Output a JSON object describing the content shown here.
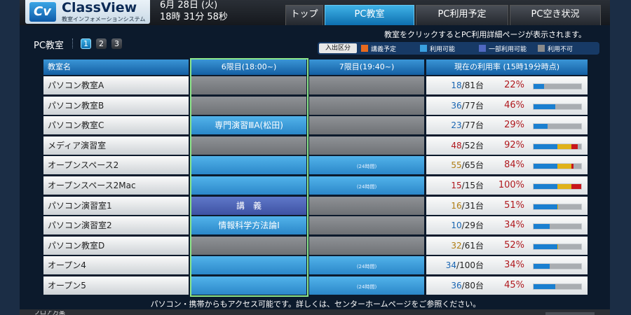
{
  "header": {
    "logo_title": "ClassView",
    "logo_subtitle": "教室インフォメーションシステム",
    "date": "6月 28日 (火)",
    "time": "18時 31分 58秒",
    "nav": [
      "トップ",
      "PC教室",
      "PC利用予定",
      "PC空き状況"
    ],
    "active_nav": "PC教室"
  },
  "subheader": {
    "title": "PC教室",
    "pages": [
      "1",
      "2",
      "3"
    ],
    "active_page": "1",
    "notice": "教室をクリックするとPC利用詳細ページが表示されます。"
  },
  "legend": {
    "title": "入出区分",
    "items": [
      {
        "label": "講義予定",
        "color": "#e86a1e"
      },
      {
        "label": "利用可能",
        "color": "#3aa0e0"
      },
      {
        "label": "一部利用可能",
        "color": "#5068c0"
      },
      {
        "label": "利用不可",
        "color": "#8a8a8a"
      }
    ]
  },
  "table": {
    "headers": [
      "教室名",
      "6限目(18:00~)",
      "7限目(19:40~)",
      "現在の利用率 (15時19分時点)"
    ],
    "rows": [
      {
        "name": "パソコン教室A",
        "p6": "",
        "p6_type": "gray",
        "p7": "",
        "p7_type": "gray",
        "used": "18",
        "total": "81台",
        "pct": "22%",
        "used_color": "#1a66b3",
        "fill": 0.22
      },
      {
        "name": "パソコン教室B",
        "p6": "",
        "p6_type": "gray",
        "p7": "",
        "p7_type": "gray",
        "used": "36",
        "total": "77台",
        "pct": "46%",
        "used_color": "#1a66b3",
        "fill": 0.46
      },
      {
        "name": "パソコン教室C",
        "p6": "専門演習ⅢA(松田)",
        "p6_type": "blue",
        "p7": "",
        "p7_type": "gray",
        "used": "23",
        "total": "77台",
        "pct": "29%",
        "used_color": "#1a66b3",
        "fill": 0.29
      },
      {
        "name": "メディア演習室",
        "p6": "",
        "p6_type": "gray",
        "p7": "",
        "p7_type": "gray",
        "used": "48",
        "total": "52台",
        "pct": "92%",
        "used_color": "#b0191e",
        "fill": 0.92
      },
      {
        "name": "オープンスペース2",
        "p6": "",
        "p6_type": "blue",
        "p7": "(24時間)",
        "p7_type": "blue",
        "used": "55",
        "total": "65台",
        "pct": "84%",
        "used_color": "#b07d12",
        "fill": 0.84
      },
      {
        "name": "オープンスペース2Mac",
        "p6": "",
        "p6_type": "blue",
        "p7": "(24時間)",
        "p7_type": "blue",
        "used": "15",
        "total": "15台",
        "pct": "100%",
        "used_color": "#b0191e",
        "fill": 1.0
      },
      {
        "name": "パソコン演習室1",
        "p6": "講　義",
        "p6_type": "class",
        "p7": "",
        "p7_type": "gray",
        "used": "16",
        "total": "31台",
        "pct": "51%",
        "used_color": "#b07d12",
        "fill": 0.51
      },
      {
        "name": "パソコン演習室2",
        "p6": "情報科学方法論Ⅰ",
        "p6_type": "blue",
        "p7": "",
        "p7_type": "gray",
        "used": "10",
        "total": "29台",
        "pct": "34%",
        "used_color": "#1a66b3",
        "fill": 0.34
      },
      {
        "name": "パソコン教室D",
        "p6": "",
        "p6_type": "gray",
        "p7": "",
        "p7_type": "gray",
        "used": "32",
        "total": "61台",
        "pct": "52%",
        "used_color": "#b07d12",
        "fill": 0.52
      },
      {
        "name": "オープン4",
        "p6": "",
        "p6_type": "blue",
        "p7": "(24時間)",
        "p7_type": "blue",
        "used": "34",
        "total": "100台",
        "pct": "34%",
        "used_color": "#1a66b3",
        "fill": 0.34
      },
      {
        "name": "オープン5",
        "p6": "",
        "p6_type": "blue",
        "p7": "(24時間)",
        "p7_type": "blue",
        "used": "36",
        "total": "80台",
        "pct": "45%",
        "used_color": "#1a66b3",
        "fill": 0.45
      }
    ]
  },
  "footer": {
    "message": "パソコン・携帯からもアクセス可能です。詳しくは、センターホームページをご参照ください。",
    "bottom_label": "フロア方案"
  }
}
